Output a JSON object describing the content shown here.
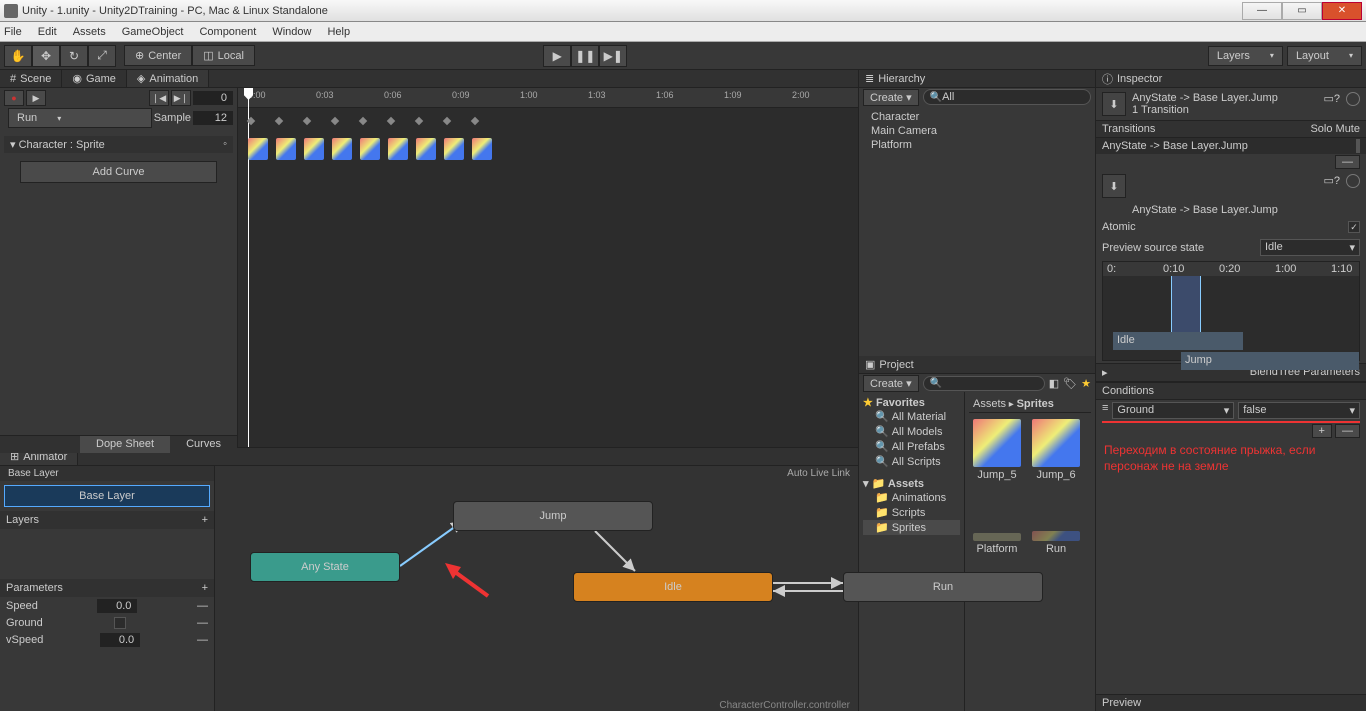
{
  "window": {
    "title": "Unity - 1.unity - Unity2DTraining - PC, Mac & Linux Standalone"
  },
  "menu": {
    "file": "File",
    "edit": "Edit",
    "assets": "Assets",
    "gameObject": "GameObject",
    "component": "Component",
    "window": "Window",
    "help": "Help"
  },
  "toolbar": {
    "center": "Center",
    "local": "Local",
    "layers": "Layers",
    "layout": "Layout"
  },
  "tabs": {
    "scene": "Scene",
    "game": "Game",
    "animation": "Animation",
    "animator": "Animator"
  },
  "animation": {
    "clipName": "Run",
    "sampleLabel": "Sample",
    "sampleValue": "12",
    "frame": "0",
    "propertyPath": "Character : Sprite",
    "addCurve": "Add Curve",
    "ticks": [
      "0:00",
      "0:03",
      "0:06",
      "0:09",
      "1:00",
      "1:03",
      "1:06",
      "1:09",
      "2:00"
    ],
    "dopeSheet": "Dope Sheet",
    "curves": "Curves"
  },
  "animator": {
    "baseLayer": "Base Layer",
    "layers": "Layers",
    "parameters": "Parameters",
    "autoLive": "Auto Live Link",
    "params": [
      {
        "name": "Speed",
        "value": "0.0",
        "type": "float"
      },
      {
        "name": "Ground",
        "value": "",
        "type": "bool"
      },
      {
        "name": "vSpeed",
        "value": "0.0",
        "type": "float"
      }
    ],
    "states": {
      "anyState": "Any State",
      "jump": "Jump",
      "idle": "Idle",
      "run": "Run"
    },
    "controllerPath": "CharacterController.controller"
  },
  "hierarchy": {
    "title": "Hierarchy",
    "create": "Create",
    "all": "All",
    "items": [
      "Character",
      "Main Camera",
      "Platform"
    ]
  },
  "project": {
    "title": "Project",
    "create": "Create",
    "favorites": "Favorites",
    "favItems": [
      "All Material",
      "All Models",
      "All Prefabs",
      "All Scripts"
    ],
    "assets": "Assets",
    "folders": [
      "Animations",
      "Scripts",
      "Sprites"
    ],
    "breadcrumb": [
      "Assets",
      "Sprites"
    ],
    "thumbs": [
      "Jump_5",
      "Jump_6",
      "Platform",
      "Run"
    ]
  },
  "inspector": {
    "title": "Inspector",
    "transitionName": "AnyState -> Base Layer.Jump",
    "transitionCount": "1 Transition",
    "transitionsHdr": "Transitions",
    "solo": "Solo",
    "mute": "Mute",
    "transRow": "AnyState -> Base Layer.Jump",
    "atomic": "Atomic",
    "previewSource": "Preview source state",
    "previewVal": "Idle",
    "tlTicks": [
      "0:",
      "0:10",
      "0:20",
      "1:00",
      "1:10"
    ],
    "idleBar": "Idle",
    "jumpBar": "Jump",
    "blendTree": "BlendTree Parameters",
    "conditions": "Conditions",
    "condParam": "Ground",
    "condValue": "false",
    "annotation": "Переходим в состояние прыжка, если персонаж не на земле",
    "preview": "Preview"
  }
}
